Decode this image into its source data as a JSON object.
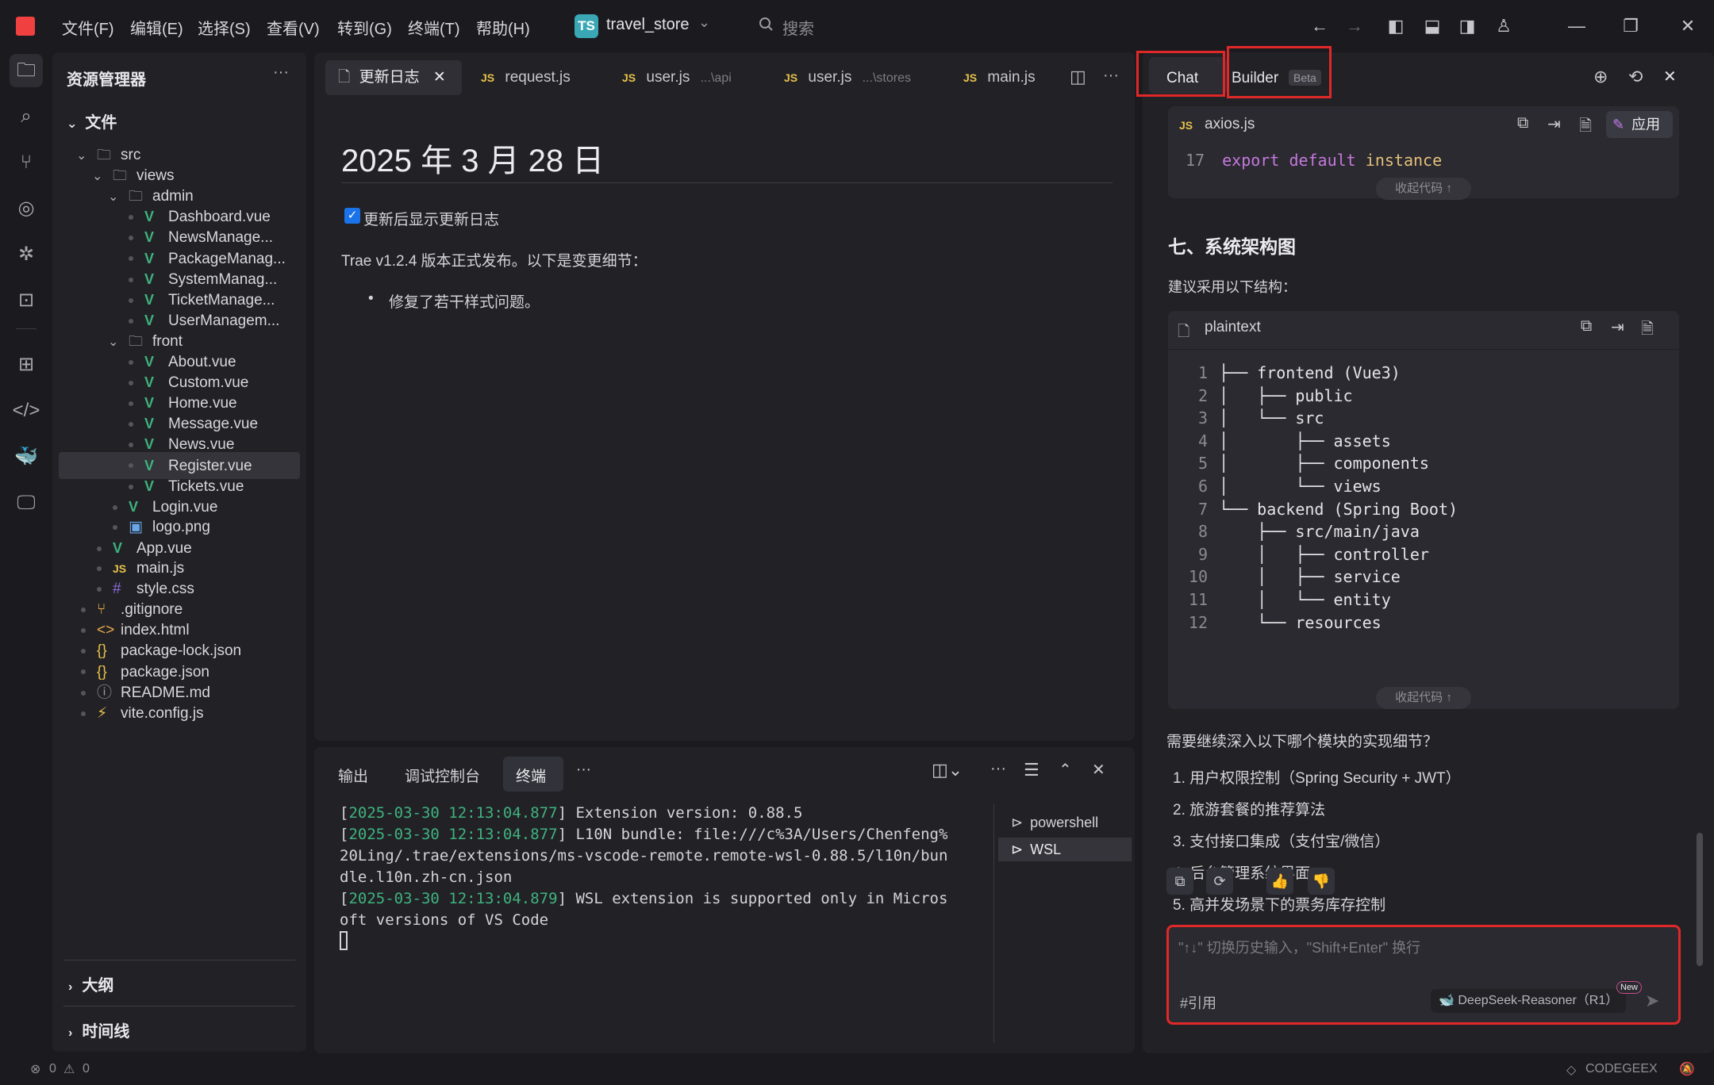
{
  "menu": [
    "文件(F)",
    "编辑(E)",
    "选择(S)",
    "查看(V)",
    "转到(G)",
    "终端(T)",
    "帮助(H)"
  ],
  "project": {
    "badge": "TS",
    "name": "travel_store"
  },
  "search": {
    "label": "搜索"
  },
  "explorer": {
    "title": "资源管理器",
    "section_files": "文件",
    "tree": [
      {
        "name": "src",
        "type": "folder"
      },
      {
        "name": "views",
        "type": "folder"
      },
      {
        "name": "admin",
        "type": "folder"
      },
      {
        "name": "Dashboard.vue",
        "type": "vue"
      },
      {
        "name": "NewsManage...",
        "type": "vue"
      },
      {
        "name": "PackageManag...",
        "type": "vue"
      },
      {
        "name": "SystemManag...",
        "type": "vue"
      },
      {
        "name": "TicketManage...",
        "type": "vue"
      },
      {
        "name": "UserManagem...",
        "type": "vue"
      },
      {
        "name": "front",
        "type": "folder"
      },
      {
        "name": "About.vue",
        "type": "vue"
      },
      {
        "name": "Custom.vue",
        "type": "vue"
      },
      {
        "name": "Home.vue",
        "type": "vue"
      },
      {
        "name": "Message.vue",
        "type": "vue"
      },
      {
        "name": "News.vue",
        "type": "vue"
      },
      {
        "name": "Register.vue",
        "type": "vue"
      },
      {
        "name": "Tickets.vue",
        "type": "vue"
      },
      {
        "name": "Login.vue",
        "type": "vue"
      },
      {
        "name": "logo.png",
        "type": "image"
      },
      {
        "name": "App.vue",
        "type": "vue"
      },
      {
        "name": "main.js",
        "type": "js"
      },
      {
        "name": "style.css",
        "type": "css"
      },
      {
        "name": ".gitignore",
        "type": "git"
      },
      {
        "name": "index.html",
        "type": "html"
      },
      {
        "name": "package-lock.json",
        "type": "json"
      },
      {
        "name": "package.json",
        "type": "json"
      },
      {
        "name": "README.md",
        "type": "md"
      },
      {
        "name": "vite.config.js",
        "type": "vite"
      }
    ],
    "section_outline": "大纲",
    "section_timeline": "时间线"
  },
  "editor": {
    "tabs": [
      {
        "label": "更新日志",
        "icon": "file-icon"
      },
      {
        "label": "request.js",
        "icon": "JS"
      },
      {
        "label": "user.js",
        "path": "...\\api",
        "icon": "JS"
      },
      {
        "label": "user.js",
        "path": "...\\stores",
        "icon": "JS"
      },
      {
        "label": "main.js",
        "icon": "JS"
      }
    ],
    "heading": "2025 年 3 月 28 日",
    "checkbox_label": "更新后显示更新日志",
    "checkbox_checked": true,
    "intro": "Trae v1.2.4 版本正式发布。以下是变更细节：",
    "bullets": [
      "修复了若干样式问题。"
    ]
  },
  "panel": {
    "tabs": [
      "输出",
      "调试控制台",
      "终端"
    ],
    "more": "···",
    "terminal_lines": [
      {
        "ts": "2025-03-30 12:13:04.877",
        "text": "] Extension version: 0.88.5"
      },
      {
        "ts": "2025-03-30 12:13:04.877",
        "text": "] L10N bundle: file:///c%3A/Users/Chenfeng%"
      },
      {
        "ts": "",
        "text": "20Ling/.trae/extensions/ms-vscode-remote.remote-wsl-0.88.5/l10n/bun"
      },
      {
        "ts": "",
        "text": "dle.l10n.zh-cn.json"
      },
      {
        "ts": "2025-03-30 12:13:04.879",
        "text": "] WSL extension is supported only in Micros"
      },
      {
        "ts": "",
        "text": "oft versions of VS Code"
      }
    ],
    "terminals": [
      "powershell",
      "WSL"
    ]
  },
  "chat": {
    "tab_chat": "Chat",
    "tab_builder": "Builder",
    "beta": "Beta",
    "code1": {
      "file": "axios.js",
      "lang_badge": "JS",
      "apply": "应用",
      "line_no": "17",
      "kw1": "export",
      "kw2": "default",
      "ident": "instance"
    },
    "collapse_label": "收起代码 ↑",
    "section_title": "七、系统架构图",
    "suggest": "建议采用以下结构：",
    "code2": {
      "lang": "plaintext",
      "lines": [
        {
          "n": "1",
          "t": "├── frontend (Vue3)"
        },
        {
          "n": "2",
          "t": "│   ├── public"
        },
        {
          "n": "3",
          "t": "│   └── src"
        },
        {
          "n": "4",
          "t": "│       ├── assets"
        },
        {
          "n": "5",
          "t": "│       ├── components"
        },
        {
          "n": "6",
          "t": "│       └── views"
        },
        {
          "n": "7",
          "t": "└── backend (Spring Boot)"
        },
        {
          "n": "8",
          "t": "    ├── src/main/java"
        },
        {
          "n": "9",
          "t": "    │   ├── controller"
        },
        {
          "n": "10",
          "t": "    │   ├── service"
        },
        {
          "n": "11",
          "t": "    │   └── entity"
        },
        {
          "n": "12",
          "t": "    └── resources"
        }
      ]
    },
    "question": "需要继续深入以下哪个模块的实现细节？",
    "options": [
      "1. 用户权限控制（Spring Security + JWT）",
      "2. 旅游套餐的推荐算法",
      "3. 支付接口集成（支付宝/微信）",
      "4. 后台管理系统界面",
      "5. 高并发场景下的票务库存控制"
    ],
    "input_placeholder": "\"↑↓\" 切换历史输入，\"Shift+Enter\" 换行",
    "cite": "#引用",
    "model": "DeepSeek-Reasoner（R1）",
    "new_badge": "New"
  },
  "status": {
    "errors": "0",
    "warnings": "0",
    "codegeex": "CODEGEEX"
  },
  "colors": {
    "accent_red": "#e02828",
    "vue_green": "#3fb27f",
    "ts_blue": "#3aa7b5",
    "js_yellow": "#e8c14a",
    "checkbox_blue": "#1a73e8"
  }
}
